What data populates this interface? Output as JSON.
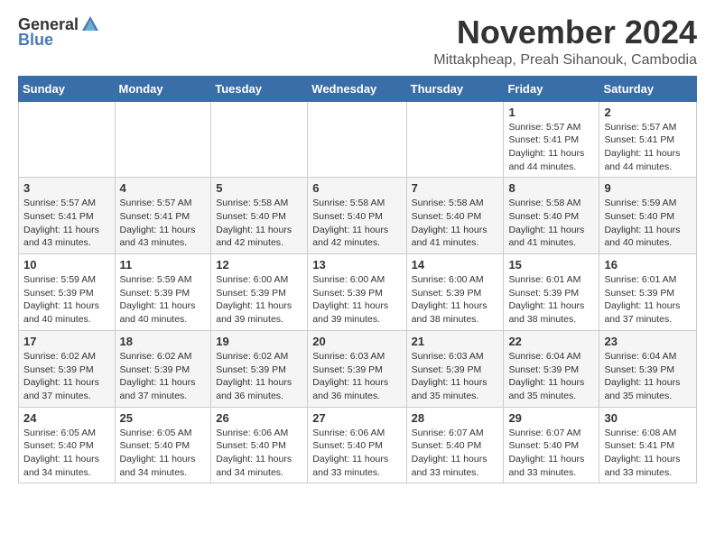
{
  "logo": {
    "general": "General",
    "blue": "Blue"
  },
  "title": "November 2024",
  "location": "Mittakpheap, Preah Sihanouk, Cambodia",
  "weekdays": [
    "Sunday",
    "Monday",
    "Tuesday",
    "Wednesday",
    "Thursday",
    "Friday",
    "Saturday"
  ],
  "weeks": [
    [
      {
        "day": "",
        "info": ""
      },
      {
        "day": "",
        "info": ""
      },
      {
        "day": "",
        "info": ""
      },
      {
        "day": "",
        "info": ""
      },
      {
        "day": "",
        "info": ""
      },
      {
        "day": "1",
        "info": "Sunrise: 5:57 AM\nSunset: 5:41 PM\nDaylight: 11 hours\nand 44 minutes."
      },
      {
        "day": "2",
        "info": "Sunrise: 5:57 AM\nSunset: 5:41 PM\nDaylight: 11 hours\nand 44 minutes."
      }
    ],
    [
      {
        "day": "3",
        "info": "Sunrise: 5:57 AM\nSunset: 5:41 PM\nDaylight: 11 hours\nand 43 minutes."
      },
      {
        "day": "4",
        "info": "Sunrise: 5:57 AM\nSunset: 5:41 PM\nDaylight: 11 hours\nand 43 minutes."
      },
      {
        "day": "5",
        "info": "Sunrise: 5:58 AM\nSunset: 5:40 PM\nDaylight: 11 hours\nand 42 minutes."
      },
      {
        "day": "6",
        "info": "Sunrise: 5:58 AM\nSunset: 5:40 PM\nDaylight: 11 hours\nand 42 minutes."
      },
      {
        "day": "7",
        "info": "Sunrise: 5:58 AM\nSunset: 5:40 PM\nDaylight: 11 hours\nand 41 minutes."
      },
      {
        "day": "8",
        "info": "Sunrise: 5:58 AM\nSunset: 5:40 PM\nDaylight: 11 hours\nand 41 minutes."
      },
      {
        "day": "9",
        "info": "Sunrise: 5:59 AM\nSunset: 5:40 PM\nDaylight: 11 hours\nand 40 minutes."
      }
    ],
    [
      {
        "day": "10",
        "info": "Sunrise: 5:59 AM\nSunset: 5:39 PM\nDaylight: 11 hours\nand 40 minutes."
      },
      {
        "day": "11",
        "info": "Sunrise: 5:59 AM\nSunset: 5:39 PM\nDaylight: 11 hours\nand 40 minutes."
      },
      {
        "day": "12",
        "info": "Sunrise: 6:00 AM\nSunset: 5:39 PM\nDaylight: 11 hours\nand 39 minutes."
      },
      {
        "day": "13",
        "info": "Sunrise: 6:00 AM\nSunset: 5:39 PM\nDaylight: 11 hours\nand 39 minutes."
      },
      {
        "day": "14",
        "info": "Sunrise: 6:00 AM\nSunset: 5:39 PM\nDaylight: 11 hours\nand 38 minutes."
      },
      {
        "day": "15",
        "info": "Sunrise: 6:01 AM\nSunset: 5:39 PM\nDaylight: 11 hours\nand 38 minutes."
      },
      {
        "day": "16",
        "info": "Sunrise: 6:01 AM\nSunset: 5:39 PM\nDaylight: 11 hours\nand 37 minutes."
      }
    ],
    [
      {
        "day": "17",
        "info": "Sunrise: 6:02 AM\nSunset: 5:39 PM\nDaylight: 11 hours\nand 37 minutes."
      },
      {
        "day": "18",
        "info": "Sunrise: 6:02 AM\nSunset: 5:39 PM\nDaylight: 11 hours\nand 37 minutes."
      },
      {
        "day": "19",
        "info": "Sunrise: 6:02 AM\nSunset: 5:39 PM\nDaylight: 11 hours\nand 36 minutes."
      },
      {
        "day": "20",
        "info": "Sunrise: 6:03 AM\nSunset: 5:39 PM\nDaylight: 11 hours\nand 36 minutes."
      },
      {
        "day": "21",
        "info": "Sunrise: 6:03 AM\nSunset: 5:39 PM\nDaylight: 11 hours\nand 35 minutes."
      },
      {
        "day": "22",
        "info": "Sunrise: 6:04 AM\nSunset: 5:39 PM\nDaylight: 11 hours\nand 35 minutes."
      },
      {
        "day": "23",
        "info": "Sunrise: 6:04 AM\nSunset: 5:39 PM\nDaylight: 11 hours\nand 35 minutes."
      }
    ],
    [
      {
        "day": "24",
        "info": "Sunrise: 6:05 AM\nSunset: 5:40 PM\nDaylight: 11 hours\nand 34 minutes."
      },
      {
        "day": "25",
        "info": "Sunrise: 6:05 AM\nSunset: 5:40 PM\nDaylight: 11 hours\nand 34 minutes."
      },
      {
        "day": "26",
        "info": "Sunrise: 6:06 AM\nSunset: 5:40 PM\nDaylight: 11 hours\nand 34 minutes."
      },
      {
        "day": "27",
        "info": "Sunrise: 6:06 AM\nSunset: 5:40 PM\nDaylight: 11 hours\nand 33 minutes."
      },
      {
        "day": "28",
        "info": "Sunrise: 6:07 AM\nSunset: 5:40 PM\nDaylight: 11 hours\nand 33 minutes."
      },
      {
        "day": "29",
        "info": "Sunrise: 6:07 AM\nSunset: 5:40 PM\nDaylight: 11 hours\nand 33 minutes."
      },
      {
        "day": "30",
        "info": "Sunrise: 6:08 AM\nSunset: 5:41 PM\nDaylight: 11 hours\nand 33 minutes."
      }
    ]
  ]
}
